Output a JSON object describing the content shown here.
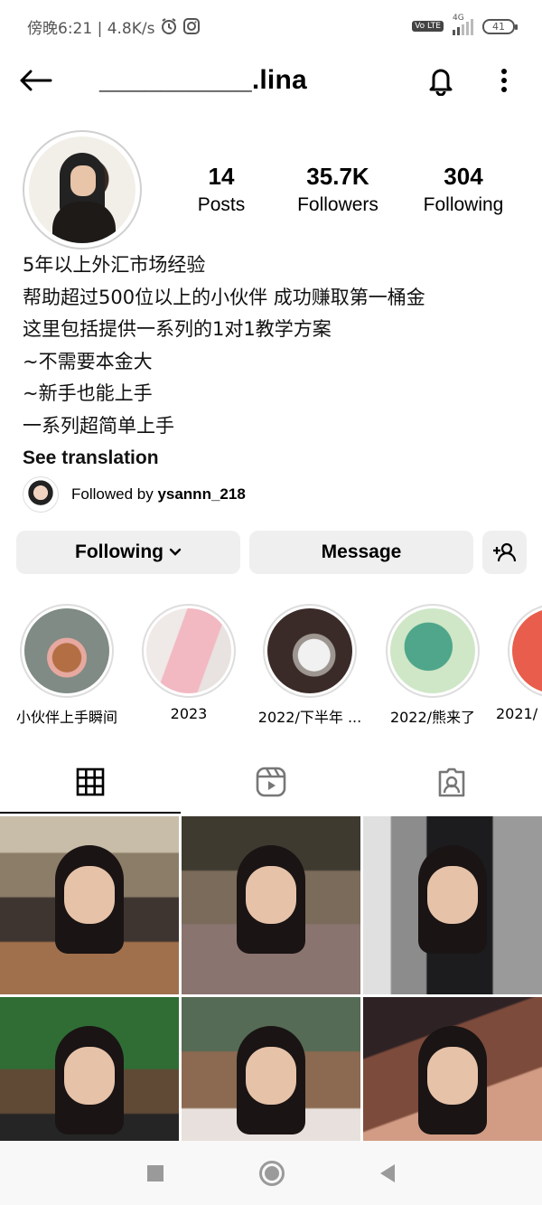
{
  "status_bar": {
    "time_speed": "傍晚6:21 | 4.8K/s",
    "network": "4G",
    "volte": "Vo LTE",
    "battery": "41"
  },
  "header": {
    "username": "__________.lina"
  },
  "stats": {
    "posts": {
      "value": "14",
      "label": "Posts"
    },
    "followers": {
      "value": "35.7K",
      "label": "Followers"
    },
    "following": {
      "value": "304",
      "label": "Following"
    }
  },
  "bio": {
    "lines": [
      "5年以上外汇市场经验",
      "帮助超过500位以上的小伙伴 成功赚取第一桶金",
      "这里包括提供一系列的1对1教学方案",
      "~不需要本金大",
      "~新手也能上手",
      "一系列超简单上手"
    ],
    "see_translation": "See translation"
  },
  "followed_by": {
    "prefix": "Followed by ",
    "user": "ysannn_218"
  },
  "buttons": {
    "following": "Following",
    "message": "Message"
  },
  "highlights": [
    {
      "caption": "小伙伴上手瞬间"
    },
    {
      "caption": "2023"
    },
    {
      "caption": "2022/下半年 ..."
    },
    {
      "caption": "2022/熊来了"
    },
    {
      "caption": "2021/"
    }
  ],
  "tabs": [
    "grid-icon",
    "reels-icon",
    "tagged-icon"
  ],
  "icons": {
    "back": "arrow-left-icon",
    "bell": "bell-icon",
    "more": "more-vertical-icon",
    "dropdown": "chevron-down-icon",
    "add_user": "add-user-icon"
  }
}
